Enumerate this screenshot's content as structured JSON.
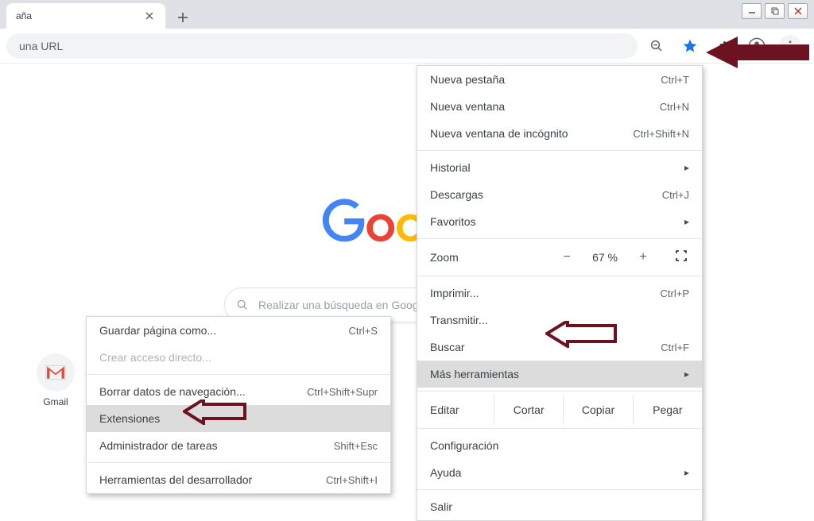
{
  "tab": {
    "title": "aña"
  },
  "addr": {
    "placeholder": "una URL"
  },
  "ntp": {
    "search_placeholder": "Realizar una búsqueda en Google o escribir una URL",
    "shortcut_label": "Gmail"
  },
  "menu": {
    "new_tab": {
      "label": "Nueva pestaña",
      "key": "Ctrl+T"
    },
    "new_win": {
      "label": "Nueva ventana",
      "key": "Ctrl+N"
    },
    "incog": {
      "label": "Nueva ventana de incógnito",
      "key": "Ctrl+Shift+N"
    },
    "history": {
      "label": "Historial"
    },
    "downloads": {
      "label": "Descargas",
      "key": "Ctrl+J"
    },
    "bookmarks": {
      "label": "Favoritos"
    },
    "zoom": {
      "label": "Zoom",
      "minus": "−",
      "value": "67 %",
      "plus": "+"
    },
    "print": {
      "label": "Imprimir...",
      "key": "Ctrl+P"
    },
    "cast": {
      "label": "Transmitir..."
    },
    "find": {
      "label": "Buscar",
      "key": "Ctrl+F"
    },
    "tools": {
      "label": "Más herramientas"
    },
    "edit": {
      "label": "Editar",
      "cut": "Cortar",
      "copy": "Copiar",
      "paste": "Pegar"
    },
    "settings": {
      "label": "Configuración"
    },
    "help": {
      "label": "Ayuda"
    },
    "exit": {
      "label": "Salir"
    }
  },
  "submenu": {
    "save_as": {
      "label": "Guardar página como...",
      "key": "Ctrl+S"
    },
    "shortcut": {
      "label": "Crear acceso directo..."
    },
    "clear": {
      "label": "Borrar datos de navegación...",
      "key": "Ctrl+Shift+Supr"
    },
    "ext": {
      "label": "Extensiones"
    },
    "taskmgr": {
      "label": "Administrador de tareas",
      "key": "Shift+Esc"
    },
    "devtools": {
      "label": "Herramientas del desarrollador",
      "key": "Ctrl+Shift+I"
    }
  }
}
